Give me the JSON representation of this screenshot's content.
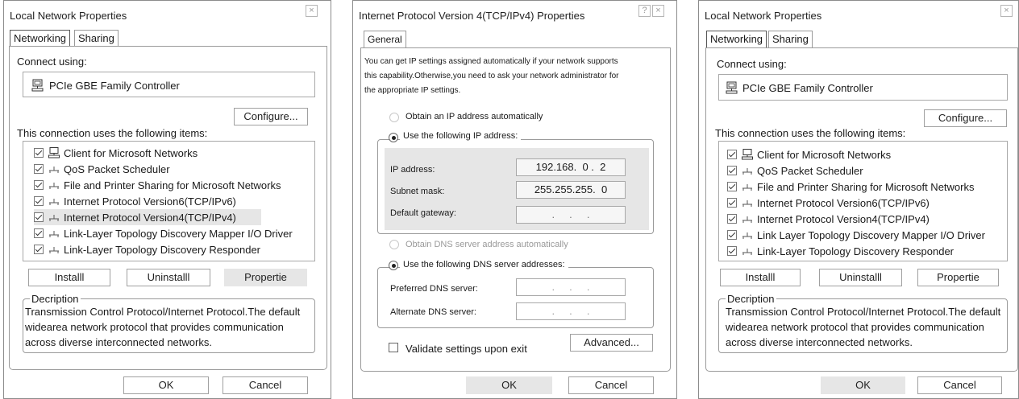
{
  "dialog1": {
    "title": "Local Network Properties",
    "tabs": [
      "Networking",
      "Sharing"
    ],
    "connect_using_label": "Connect using:",
    "adapter_name": "PCIe GBE Family Controller",
    "configure_label": "Configure...",
    "items_label": "This connection uses the following items:",
    "items": [
      {
        "label": "Client for Microsoft Networks",
        "icon": "computer-icon",
        "checked": true
      },
      {
        "label": "QoS Packet Scheduler",
        "icon": "network-protocol-icon",
        "checked": true
      },
      {
        "label": "File and Printer Sharing for Microsoft Networks",
        "icon": "network-protocol-icon",
        "checked": true
      },
      {
        "label": "Internet Protocol Version6(TCP/IPv6)",
        "icon": "network-protocol-icon",
        "checked": true
      },
      {
        "label": "Internet Protocol Version4(TCP/IPv4)",
        "icon": "network-protocol-icon",
        "checked": true,
        "selected": true
      },
      {
        "label": "Link-Layer Topology Discovery Mapper I/O Driver",
        "icon": "network-protocol-icon",
        "checked": true
      },
      {
        "label": "Link-Layer Topology Discovery Responder",
        "icon": "network-protocol-icon",
        "checked": true
      }
    ],
    "install_label": "Installl",
    "uninstall_label": "Uninstalll",
    "properties_label": "Propertie",
    "description_legend": "Decription",
    "description_lines": [
      "Transmission Control Protocol/Internet Protocol.The default",
      "widearea network protocol that provides communication",
      "across diverse interconnected networks."
    ],
    "ok_label": "OK",
    "cancel_label": "Cancel",
    "close_glyph": "×"
  },
  "dialog2": {
    "title": "Internet Protocol Version 4(TCP/IPv4) Properties",
    "help_glyph": "?",
    "close_glyph": "×",
    "tab": "General",
    "intro_lines": [
      "You can get IP settings assigned automatically if your network supports",
      "this capability.Otherwise,you need to ask your network administrator for",
      "the appropriate IP settings."
    ],
    "obtain_ip_label": "Obtain an IP address automatically",
    "use_ip_label": "Use the following IP address:",
    "ip_address_label": "IP address:",
    "ip_address_value": "192.168.  0 .  2",
    "subnet_mask_label": "Subnet mask:",
    "subnet_mask_value": "255.255.255.  0",
    "default_gateway_label": "Default gateway:",
    "default_gateway_value": ".     .     .",
    "obtain_dns_label": "Obtain DNS server address automatically",
    "use_dns_label": "Use the following DNS server addresses:",
    "preferred_dns_label": "Preferred DNS server:",
    "preferred_dns_value": ".     .     .",
    "alternate_dns_label": "Alternate DNS server:",
    "alternate_dns_value": ".     .     .",
    "validate_label": "Validate settings upon exit",
    "advanced_label": "Advanced...",
    "ok_label": "OK",
    "cancel_label": "Cancel",
    "ip_mode": "manual",
    "dns_mode": "manual",
    "validate_checked": false
  },
  "dialog3": {
    "title": "Local Network Properties",
    "tabs": [
      "Networking",
      "Sharing"
    ],
    "connect_using_label": "Connect using:",
    "adapter_name": "PCIe GBE Family Controller",
    "configure_label": "Configure...",
    "items_label": "This connection uses the following items:",
    "items": [
      {
        "label": "Client for Microsoft Networks",
        "icon": "computer-icon",
        "checked": true
      },
      {
        "label": "QoS Packet Scheduler",
        "icon": "network-protocol-icon",
        "checked": true
      },
      {
        "label": "File and Printer Sharing for Microsoft Networks",
        "icon": "network-protocol-icon",
        "checked": true
      },
      {
        "label": "Internet Protocol Version6(TCP/IPv6)",
        "icon": "network-protocol-icon",
        "checked": true
      },
      {
        "label": "Internet Protocol Version4(TCP/IPv4)",
        "icon": "network-protocol-icon",
        "checked": true
      },
      {
        "label": "Link Layer Topology Discovery Mapper I/O Driver",
        "icon": "network-protocol-icon",
        "checked": true
      },
      {
        "label": "Link-Layer Topology Discovery Responder",
        "icon": "network-protocol-icon",
        "checked": true
      }
    ],
    "install_label": "Installl",
    "uninstall_label": "Uninstalll",
    "properties_label": "Propertie",
    "description_legend": "Decription",
    "description_lines": [
      "Transmission Control Protocol/Internet Protocol.The default",
      "widearea network protocol that provides communication",
      "across diverse interconnected networks."
    ],
    "ok_label": "OK",
    "cancel_label": "Cancel",
    "close_glyph": "×"
  },
  "colors": {
    "border": "#9a9a9a",
    "selection": "#e6e6e6",
    "text": "#1a1a1a",
    "disabled_text": "#9a9a9a"
  }
}
